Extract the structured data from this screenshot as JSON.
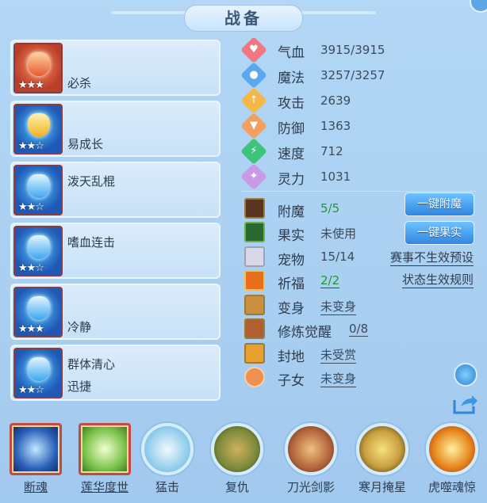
{
  "header": {
    "title": "战备"
  },
  "skills": [
    {
      "name": "必杀",
      "extra": "",
      "stars": "★★★"
    },
    {
      "name": "易成长",
      "extra": "",
      "stars": "★★☆"
    },
    {
      "name": "泼天乱棍",
      "extra": "",
      "stars": "★★☆"
    },
    {
      "name": "嗜血连击",
      "extra": "",
      "stars": "★★☆"
    },
    {
      "name": "冷静",
      "extra": "",
      "stars": "★★★"
    },
    {
      "name": "群体清心",
      "extra": "迅捷",
      "stars": "★★☆"
    }
  ],
  "stats": [
    {
      "label": "气血",
      "value": "3915/3915",
      "icon": "heart-icon",
      "color": "#f07880",
      "glyph": "♥"
    },
    {
      "label": "魔法",
      "value": "3257/3257",
      "icon": "magic-icon",
      "color": "#5aa8f0",
      "glyph": "●"
    },
    {
      "label": "攻击",
      "value": "2639",
      "icon": "attack-icon",
      "color": "#f4b84a",
      "glyph": "↑"
    },
    {
      "label": "防御",
      "value": "1363",
      "icon": "defense-icon",
      "color": "#f2a060",
      "glyph": "▼"
    },
    {
      "label": "速度",
      "value": "712",
      "icon": "speed-icon",
      "color": "#3cc47a",
      "glyph": "⚡"
    },
    {
      "label": "灵力",
      "value": "1031",
      "icon": "spirit-icon",
      "color": "#c89ae8",
      "glyph": "✦"
    }
  ],
  "attrs": [
    {
      "label": "附魔",
      "value": "5/5",
      "style": "green",
      "icon": "enchant-icon"
    },
    {
      "label": "果实",
      "value": "未使用",
      "style": "",
      "icon": "fruit-icon"
    },
    {
      "label": "宠物",
      "value": "15/14",
      "style": "",
      "icon": "pet-icon"
    },
    {
      "label": "祈福",
      "value": "2/2",
      "style": "green uline",
      "icon": "blessing-icon"
    },
    {
      "label": "变身",
      "value": "未变身",
      "style": "uline",
      "icon": "transform-icon"
    },
    {
      "label": "修炼觉醒",
      "value": "0/8",
      "style": "uline",
      "icon": "cultivation-icon"
    },
    {
      "label": "封地",
      "value": "未受赏",
      "style": "uline",
      "icon": "fief-icon"
    },
    {
      "label": "子女",
      "value": "未变身",
      "style": "uline",
      "icon": "child-icon"
    }
  ],
  "buttons": {
    "enchant": "一键附魔",
    "fruit": "一键果实"
  },
  "links": {
    "event_preset": "赛事不生效预设",
    "status_rules": "状态生效规则"
  },
  "bottom_skills": [
    {
      "label": "断魂",
      "shape": "square",
      "underline": true,
      "color": "#2a5fb8"
    },
    {
      "label": "莲华度世",
      "shape": "square",
      "underline": true,
      "color": "#7cc24a"
    },
    {
      "label": "猛击",
      "shape": "circle",
      "underline": false,
      "color": "#86c8e8"
    },
    {
      "label": "复仇",
      "shape": "circle",
      "underline": false,
      "color": "#7a8a3a"
    },
    {
      "label": "刀光剑影",
      "shape": "circle",
      "underline": false,
      "color": "#b0643a"
    },
    {
      "label": "寒月掩星",
      "shape": "circle",
      "underline": false,
      "color": "#c8a040"
    },
    {
      "label": "虎噬魂惊",
      "shape": "circle",
      "underline": false,
      "color": "#e88a20"
    }
  ]
}
